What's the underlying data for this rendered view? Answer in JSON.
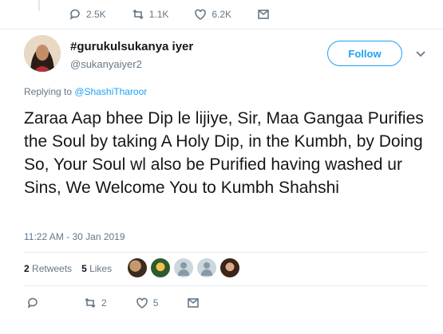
{
  "prev_tweet": {
    "replies": "2.5K",
    "retweets": "1.1K",
    "likes": "6.2K"
  },
  "author": {
    "name": "#gurukulsukanya iyer",
    "handle": "@sukanyaiyer2"
  },
  "follow_label": "Follow",
  "replying": {
    "prefix": "Replying to ",
    "mention": "@ShashiTharoor"
  },
  "tweet": {
    "text": "Zaraa Aap bhee Dip le lijiye, Sir, Maa Gangaa Purifies the Soul by taking A Holy Dip, in the Kumbh, by Doing So, Your Soul wl also be Purified having washed ur Sins, We Welcome You to Kumbh Shahshi",
    "timestamp": "11:22 AM - 30 Jan 2019"
  },
  "stats": {
    "retweets_count": "2",
    "retweets_label": "Retweets",
    "likes_count": "5",
    "likes_label": "Likes"
  },
  "actions": {
    "reply_count": "",
    "retweet_count": "2",
    "like_count": "5"
  },
  "icons": [
    "reply-icon",
    "retweet-icon",
    "like-icon",
    "message-icon",
    "chevron-down-icon"
  ],
  "colors": {
    "accent": "#1da1f2",
    "muted": "#657786",
    "text": "#14171a"
  }
}
